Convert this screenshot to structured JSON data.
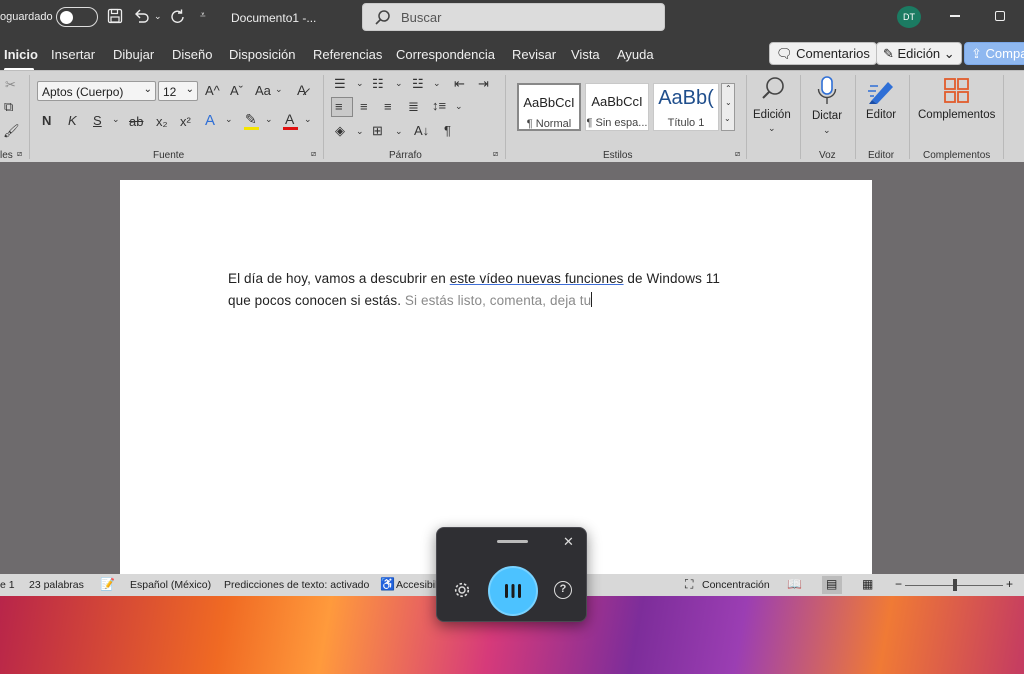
{
  "titlebar": {
    "autosave_label": "oguardado",
    "doc_title": "Documento1  -...",
    "search_placeholder": "Buscar",
    "avatar_initials": "DT"
  },
  "menu": {
    "tabs": [
      "Inicio",
      "Insertar",
      "Dibujar",
      "Diseño",
      "Disposición",
      "Referencias",
      "Correspondencia",
      "Revisar",
      "Vista",
      "Ayuda"
    ],
    "comments": "Comentarios",
    "editing": "Edición",
    "share": "Compa"
  },
  "ribbon": {
    "font_name": "Aptos (Cuerpo)",
    "font_size": "12",
    "groups": {
      "clipboard": "les",
      "font": "Fuente",
      "paragraph": "Párrafo",
      "styles": "Estilos",
      "voice": "Voz",
      "editor": "Editor",
      "addins": "Complementos"
    },
    "styles": [
      {
        "sample": "AaBbCcI",
        "name": "¶ Normal"
      },
      {
        "sample": "AaBbCcI",
        "name": "¶ Sin espa..."
      },
      {
        "sample": "AaBb(",
        "name": "Título 1"
      }
    ],
    "edicion": "Edición",
    "dictar": "Dictar",
    "editor": "Editor",
    "complementos": "Complementos",
    "glyphs": {
      "bold": "N",
      "italic": "K",
      "underline": "S",
      "strike": "ab",
      "sub": "x₂",
      "sup": "x²",
      "grow": "A^",
      "shrink": "Aˇ",
      "case": "Aa"
    }
  },
  "document": {
    "line1_pre": "El día de hoy, vamos a descubrir en ",
    "line1_link": "este vídeo nuevas funciones",
    "line1_post": " de Windows 11",
    "line2_main": "que pocos conocen si estás.",
    "line2_pred": " Si estás listo, comenta, deja tu"
  },
  "status": {
    "page": "e 1",
    "words": "23 palabras",
    "language": "Español (México)",
    "predictions": "Predicciones de texto: activado",
    "accessibility": "Accesibili",
    "focus": "Concentración",
    "zoom_minus": "−",
    "zoom_plus": "+"
  },
  "voice": {
    "close": "✕",
    "help": "?"
  }
}
